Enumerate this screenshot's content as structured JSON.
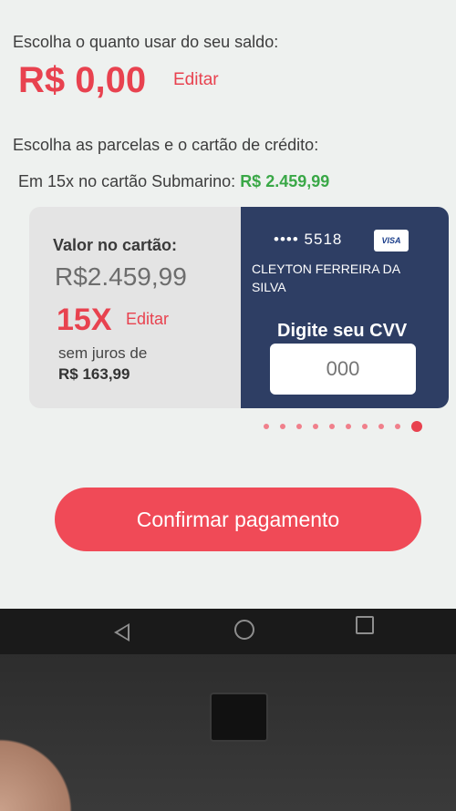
{
  "balance": {
    "prompt": "Escolha o quanto usar do seu saldo:",
    "value": "R$ 0,00",
    "edit_label": "Editar"
  },
  "installments": {
    "prompt": "Escolha as parcelas e o cartão de crédito:",
    "line_prefix": "Em",
    "count": "15x",
    "line_middle": "no cartão Submarino:",
    "total": "R$ 2.459,99"
  },
  "summary": {
    "label": "Valor no cartão:",
    "amount": "R$2.459,99",
    "parcels": "15X",
    "edit_label": "Editar",
    "no_interest": "sem juros de",
    "per_installment": "R$ 163,99"
  },
  "card": {
    "masked_number": "•••• 5518",
    "brand": "VISA",
    "holder": "CLEYTON FERREIRA DA SILVA",
    "cvv_label": "Digite seu CVV",
    "cvv_placeholder": "000"
  },
  "carousel": {
    "dots": 10,
    "active_index": 9
  },
  "confirm_label": "Confirmar pagamento",
  "colors": {
    "accent": "#e8424f",
    "success": "#3aa847",
    "card_bg": "#2e3e64"
  }
}
